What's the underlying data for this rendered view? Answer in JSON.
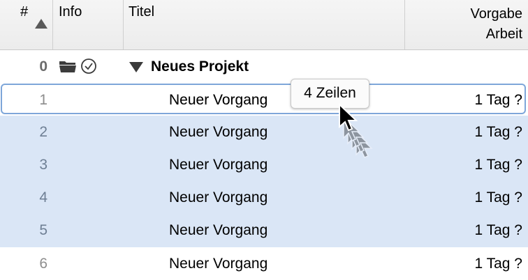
{
  "columns": {
    "number": "#",
    "info": "Info",
    "title": "Titel",
    "work_line1": "Vorgabe",
    "work_line2": "Arbeit"
  },
  "project": {
    "number": "0",
    "title": "Neues Projekt"
  },
  "rows": [
    {
      "number": "1",
      "title": "Neuer Vorgang",
      "work": "1 Tag ?"
    },
    {
      "number": "2",
      "title": "Neuer Vorgang",
      "work": "1 Tag ?"
    },
    {
      "number": "3",
      "title": "Neuer Vorgang",
      "work": "1 Tag ?"
    },
    {
      "number": "4",
      "title": "Neuer Vorgang",
      "work": "1 Tag ?"
    },
    {
      "number": "5",
      "title": "Neuer Vorgang",
      "work": "1 Tag ?"
    },
    {
      "number": "6",
      "title": "Neuer Vorgang",
      "work": "1 Tag ?"
    }
  ],
  "drag_badge": "4 Zeilen",
  "icons": {
    "sort": "sort-ascending-icon",
    "folder": "folder-icon",
    "clock": "clock-icon",
    "disclosure": "disclosure-triangle-icon",
    "cursor": "drag-copy-cursor-icon"
  },
  "colors": {
    "selection": "#dae6f6",
    "focus_ring": "#7ea6d9"
  }
}
